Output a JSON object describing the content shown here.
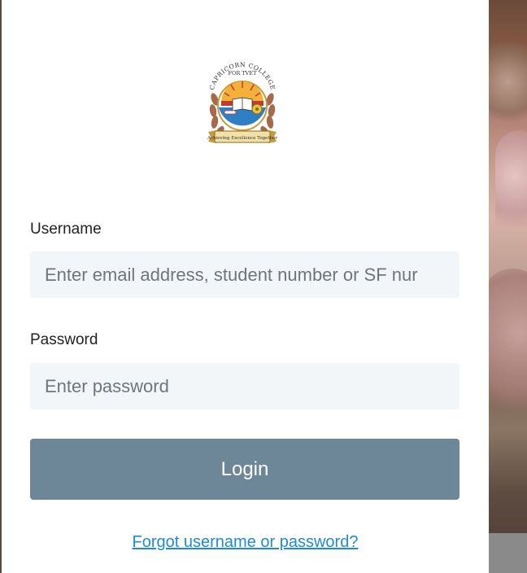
{
  "logo": {
    "name": "capricorn-college-crest",
    "ring_text": "CAPRICORN COLLEGE FOR TVET",
    "motto": "Achieving Excellence Together",
    "colors": {
      "gold": "#c99a3a",
      "laurel": "#a56a4c",
      "blue": "#2f7fc4",
      "red": "#c43a2e",
      "ribbon": "#e7c36b"
    }
  },
  "form": {
    "username_label": "Username",
    "username_placeholder": "Enter email address, student number or SF nur",
    "password_label": "Password",
    "password_placeholder": "Enter password",
    "login_label": "Login",
    "forgot_label": "Forgot username or password?"
  },
  "colors": {
    "button_bg": "#6d8799",
    "input_bg": "#f3f6f9",
    "link": "#1f8ad6"
  }
}
